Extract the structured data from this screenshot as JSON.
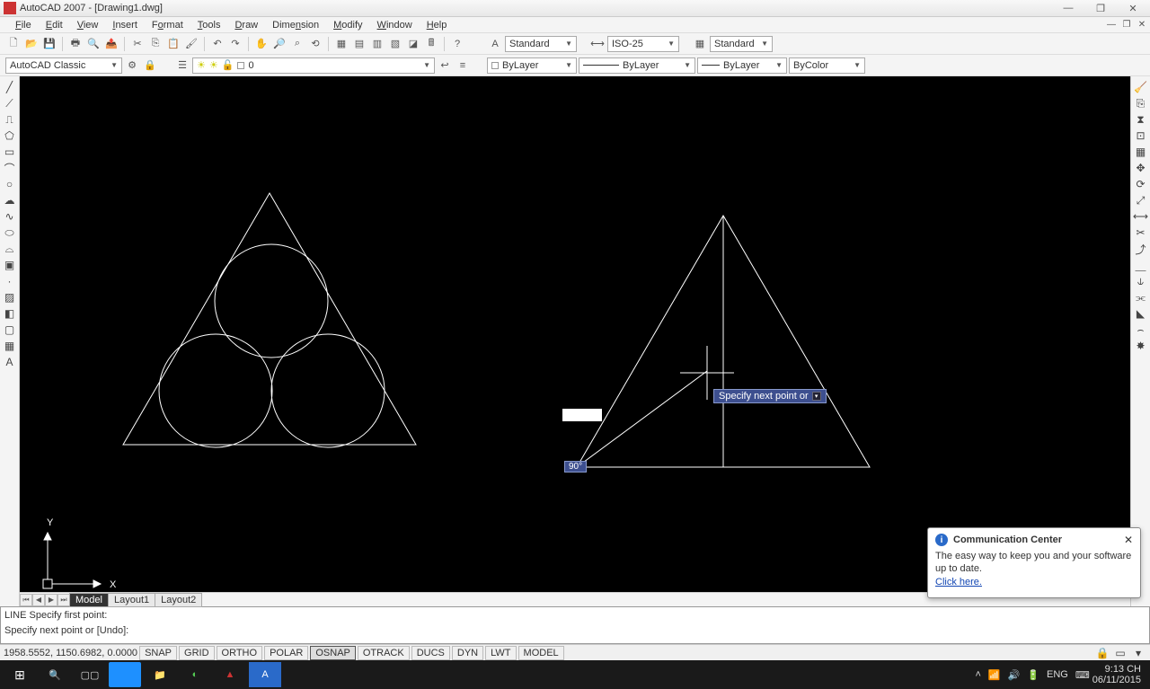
{
  "title": "AutoCAD 2007 - [Drawing1.dwg]",
  "menu": [
    "File",
    "Edit",
    "View",
    "Insert",
    "Format",
    "Tools",
    "Draw",
    "Dimension",
    "Modify",
    "Window",
    "Help"
  ],
  "workspace": "AutoCAD Classic",
  "styles": {
    "text": "Standard",
    "dim": "ISO-25",
    "table": "Standard"
  },
  "layers": {
    "color_current": "ByLayer",
    "ltype_current": "ByLayer",
    "lw_current": "ByLayer",
    "plot_current": "ByColor",
    "layer_display": "0"
  },
  "tabs": {
    "items": [
      "Model",
      "Layout1",
      "Layout2"
    ],
    "active": 0
  },
  "cmd": {
    "lines": [
      "LINE Specify first point:",
      "Specify next point or [Undo]:"
    ]
  },
  "status": {
    "coords": "1958.5552, 1150.6982, 0.0000",
    "toggles": [
      "SNAP",
      "GRID",
      "ORTHO",
      "POLAR",
      "OSNAP",
      "OTRACK",
      "DUCS",
      "DYN",
      "LWT",
      "MODEL"
    ],
    "active": [
      "OSNAP"
    ]
  },
  "tooltip": {
    "text": "Specify next point or"
  },
  "angle": "90°",
  "commcenter": {
    "title": "Communication Center",
    "body": "The easy way to keep you and your software up to date.",
    "link": "Click here."
  },
  "systray": {
    "lang": "ENG",
    "time": "9:13 CH",
    "date": "06/11/2015"
  },
  "left_tools": [
    "line",
    "xline",
    "pline",
    "polygon",
    "rectangle",
    "arc",
    "circle",
    "revcloud",
    "spline",
    "ellipse",
    "ellipse-arc",
    "block",
    "point",
    "hatch",
    "gradient",
    "region",
    "table",
    "mtext"
  ],
  "right_tools": [
    "erase",
    "copy",
    "mirror",
    "offset",
    "array",
    "move",
    "rotate",
    "scale",
    "stretch",
    "trim",
    "extend",
    "break-at",
    "break",
    "join",
    "chamfer",
    "fillet",
    "explode"
  ]
}
